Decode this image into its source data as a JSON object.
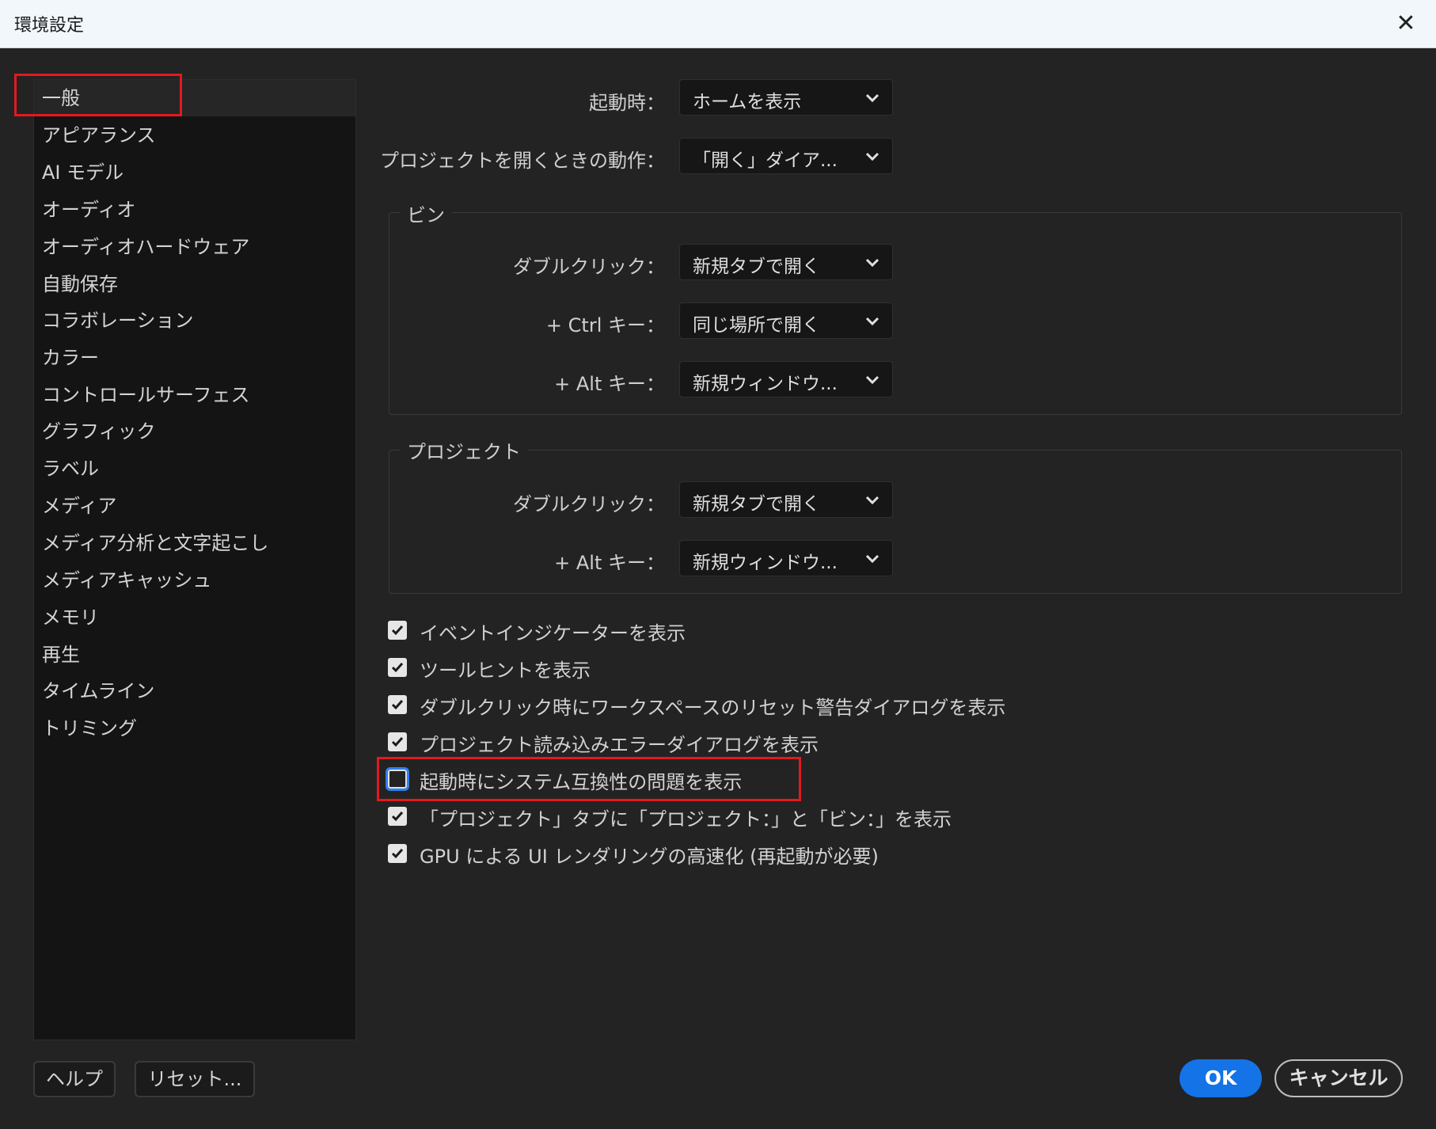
{
  "window": {
    "title": "環境設定"
  },
  "sidebar": {
    "items": [
      {
        "label": "一般"
      },
      {
        "label": "アピアランス"
      },
      {
        "label": "AI モデル"
      },
      {
        "label": "オーディオ"
      },
      {
        "label": "オーディオハードウェア"
      },
      {
        "label": "自動保存"
      },
      {
        "label": "コラボレーション"
      },
      {
        "label": "カラー"
      },
      {
        "label": "コントロールサーフェス"
      },
      {
        "label": "グラフィック"
      },
      {
        "label": "ラベル"
      },
      {
        "label": "メディア"
      },
      {
        "label": "メディア分析と文字起こし"
      },
      {
        "label": "メディアキャッシュ"
      },
      {
        "label": "メモリ"
      },
      {
        "label": "再生"
      },
      {
        "label": "タイムライン"
      },
      {
        "label": "トリミング"
      }
    ],
    "selected": "一般"
  },
  "general": {
    "startup": {
      "label": "起動時：",
      "value": "ホームを表示"
    },
    "open_project": {
      "label": "プロジェクトを開くときの動作：",
      "value": "「開く」ダイア..."
    }
  },
  "bin_group": {
    "title": "ビン",
    "double_click": {
      "label": "ダブルクリック：",
      "value": "新規タブで開く"
    },
    "ctrl": {
      "label": "+ Ctrl キー：",
      "value": "同じ場所で開く"
    },
    "alt": {
      "label": "+ Alt キー：",
      "value": "新規ウィンドウ..."
    }
  },
  "project_group": {
    "title": "プロジェクト",
    "double_click": {
      "label": "ダブルクリック：",
      "value": "新規タブで開く"
    },
    "alt": {
      "label": "+ Alt キー：",
      "value": "新規ウィンドウ..."
    }
  },
  "checkboxes": [
    {
      "label": "イベントインジケーターを表示",
      "checked": true
    },
    {
      "label": "ツールヒントを表示",
      "checked": true
    },
    {
      "label": "ダブルクリック時にワークスペースのリセット警告ダイアログを表示",
      "checked": true
    },
    {
      "label": "プロジェクト読み込みエラーダイアログを表示",
      "checked": true
    },
    {
      "label": "起動時にシステム互換性の問題を表示",
      "checked": false
    },
    {
      "label": "「プロジェクト」タブに「プロジェクト：」と「ビン：」を表示",
      "checked": true
    },
    {
      "label": "GPU による UI レンダリングの高速化 (再起動が必要)",
      "checked": true
    }
  ],
  "footer": {
    "help": "ヘルプ",
    "reset": "リセット...",
    "ok": "OK",
    "cancel": "キャンセル"
  },
  "colors": {
    "accent": "#1473e6",
    "highlight": "#e3191f",
    "focus": "#2f7ff0"
  }
}
